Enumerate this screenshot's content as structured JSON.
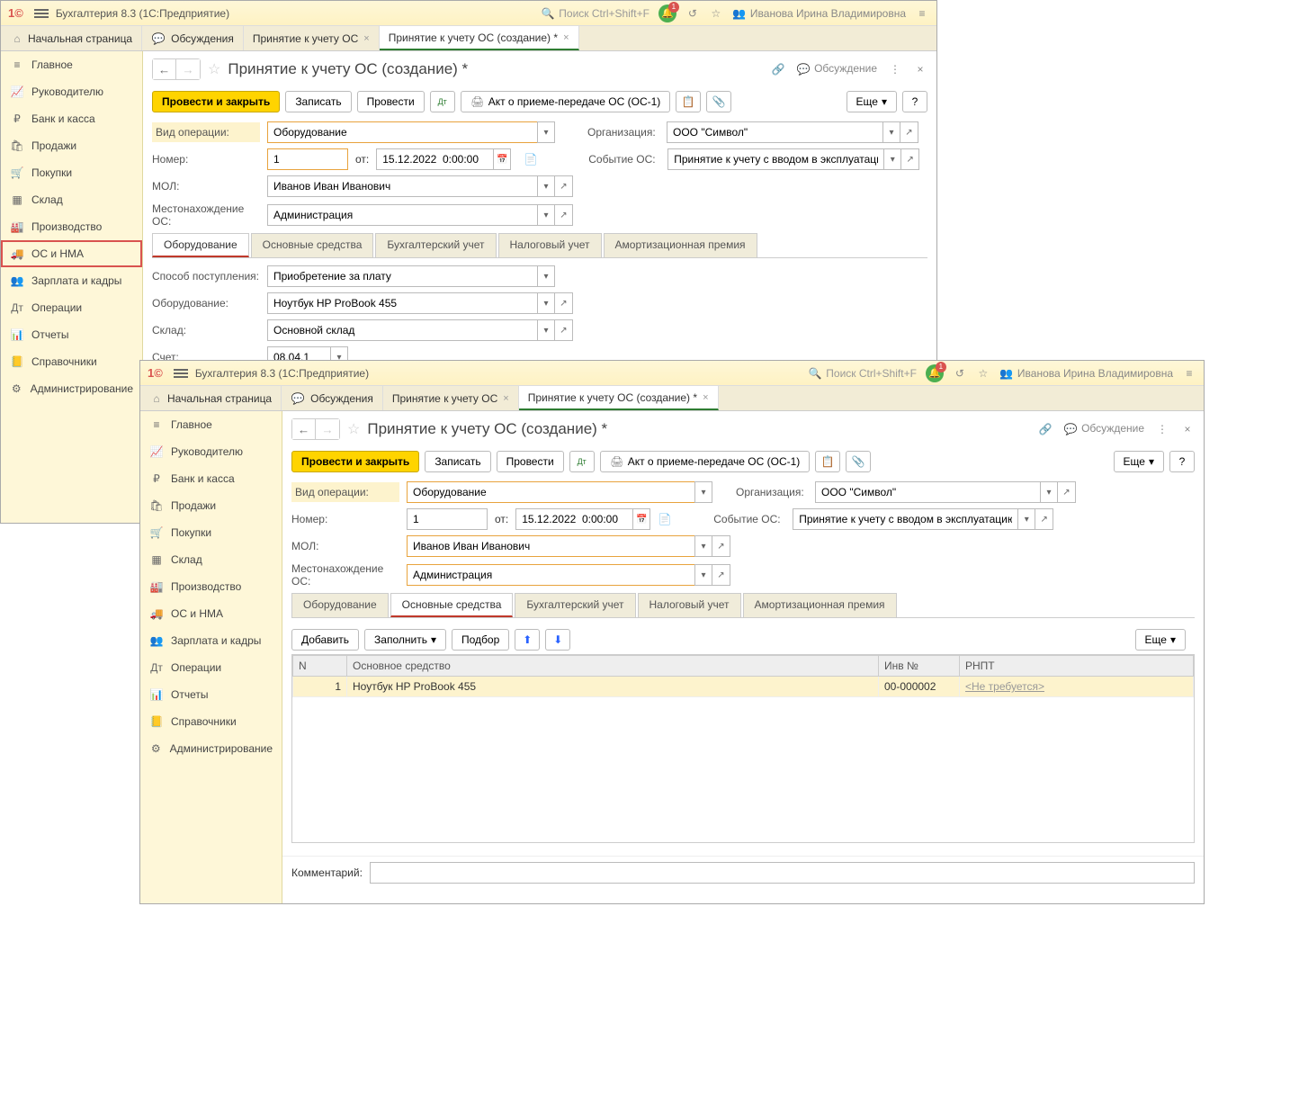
{
  "app": {
    "title": "Бухгалтерия 8.3  (1С:Предприятие)",
    "search_placeholder": "Поиск Ctrl+Shift+F",
    "user": "Иванова Ирина Владимировна",
    "bell_badge": "1"
  },
  "tabbar": {
    "home": "Начальная страница",
    "discuss": "Обсуждения",
    "tab_a": "Принятие к учету ОС",
    "tab_b": "Принятие к учету ОС (создание) *"
  },
  "sidebar": {
    "items": [
      "Главное",
      "Руководителю",
      "Банк и касса",
      "Продажи",
      "Покупки",
      "Склад",
      "Производство",
      "ОС и НМА",
      "Зарплата и кадры",
      "Операции",
      "Отчеты",
      "Справочники",
      "Администрирование"
    ]
  },
  "w1": {
    "page_title": "Принятие к учету ОС (создание) *",
    "discuss_link": "Обсуждение",
    "toolbar": {
      "post_close": "Провести и закрыть",
      "save": "Записать",
      "post": "Провести",
      "act": "Акт о приеме-передаче ОС (ОС-1)",
      "more": "Еще"
    },
    "form": {
      "op_type_label": "Вид операции:",
      "op_type": "Оборудование",
      "org_label": "Организация:",
      "org": "ООО \"Символ\"",
      "num_label": "Номер:",
      "num": "1",
      "from": "от:",
      "date": "15.12.2022  0:00:00",
      "event_label": "Событие ОС:",
      "event": "Принятие к учету с вводом в эксплуатацию",
      "mol_label": "МОЛ:",
      "mol": "Иванов Иван Иванович",
      "loc_label": "Местонахождение ОС:",
      "loc": "Администрация"
    },
    "subtabs": [
      "Оборудование",
      "Основные средства",
      "Бухгалтерский учет",
      "Налоговый учет",
      "Амортизационная премия"
    ],
    "equip": {
      "method_label": "Способ поступления:",
      "method": "Приобретение за плату",
      "equip_label": "Оборудование:",
      "equip": "Ноутбук HP ProBook 455",
      "store_label": "Склад:",
      "store": "Основной склад",
      "acct_label": "Счет:",
      "acct": "08.04.1"
    }
  },
  "w2": {
    "page_title": "Принятие к учету ОС (создание) *",
    "discuss_link": "Обсуждение",
    "toolbar": {
      "post_close": "Провести и закрыть",
      "save": "Записать",
      "post": "Провести",
      "act": "Акт о приеме-передаче ОС (ОС-1)",
      "more": "Еще"
    },
    "form": {
      "op_type_label": "Вид операции:",
      "op_type": "Оборудование",
      "org_label": "Организация:",
      "org": "ООО \"Символ\"",
      "num_label": "Номер:",
      "num": "1",
      "from": "от:",
      "date": "15.12.2022  0:00:00",
      "event_label": "Событие ОС:",
      "event": "Принятие к учету с вводом в эксплуатацию",
      "mol_label": "МОЛ:",
      "mol": "Иванов Иван Иванович",
      "loc_label": "Местонахождение ОС:",
      "loc": "Администрация"
    },
    "subtabs": [
      "Оборудование",
      "Основные средства",
      "Бухгалтерский учет",
      "Налоговый учет",
      "Амортизационная премия"
    ],
    "os_toolbar": {
      "add": "Добавить",
      "fill": "Заполнить",
      "select": "Подбор",
      "more": "Еще"
    },
    "table": {
      "cols": [
        "N",
        "Основное средство",
        "Инв №",
        "РНПТ"
      ],
      "row": {
        "n": "1",
        "name": "Ноутбук HP ProBook 455",
        "inv": "00-000002",
        "rnpt": "<Не требуется>"
      }
    },
    "comment_label": "Комментарий:"
  }
}
